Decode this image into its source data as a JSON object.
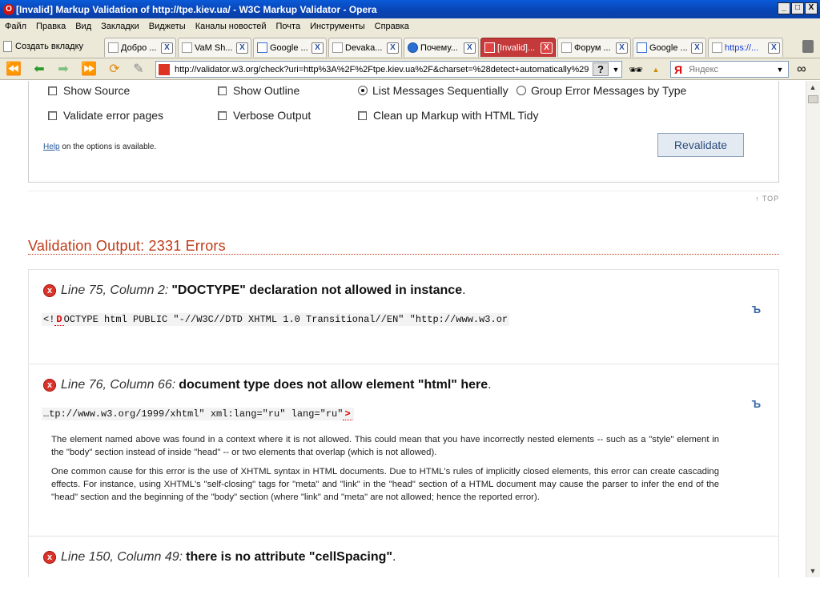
{
  "window": {
    "title": "[Invalid] Markup Validation of http://tpe.kiev.ua/ - W3C Markup Validator - Opera",
    "buttons": [
      "_",
      "□",
      "X"
    ]
  },
  "menu": [
    "Файл",
    "Правка",
    "Вид",
    "Закладки",
    "Виджеты",
    "Каналы новостей",
    "Почта",
    "Инструменты",
    "Справка"
  ],
  "tabs": {
    "new_tab_label": "Создать вкладку",
    "items": [
      {
        "label": "Добро ...",
        "favicon": "document-icon",
        "active": false
      },
      {
        "label": "VaM Sh...",
        "favicon": "document-icon",
        "active": false
      },
      {
        "label": "Google ...",
        "favicon": "google-icon",
        "active": false
      },
      {
        "label": "Devaka...",
        "favicon": "document-icon",
        "active": false
      },
      {
        "label": "Почему...",
        "favicon": "globe-icon",
        "active": false
      },
      {
        "label": "[Invalid]...",
        "favicon": "validator-icon",
        "active": true
      },
      {
        "label": "Форум ...",
        "favicon": "document-icon",
        "active": false
      },
      {
        "label": "Google ...",
        "favicon": "google-icon",
        "active": false
      },
      {
        "label": "https://...",
        "favicon": "document-icon",
        "active": false
      }
    ],
    "close_glyph": "X"
  },
  "address": {
    "url": "http://validator.w3.org/check?uri=http%3A%2F%2Ftpe.kiev.ua%2F&charset=%28detect+automatically%29",
    "help_glyph": "?",
    "search_engine_glyph": "Я",
    "search_placeholder": "Яндекс"
  },
  "options": {
    "show_source": "Show Source",
    "show_outline": "Show Outline",
    "list_sequential": "List Messages Sequentially",
    "group_by_type": "Group Error Messages by Type",
    "validate_error_pages": "Validate error pages",
    "verbose_output": "Verbose Output",
    "tidy": "Clean up Markup with HTML Tidy",
    "help_link": "Help",
    "help_rest": " on the options is available.",
    "revalidate": "Revalidate",
    "top_link": "↑ TOP"
  },
  "output": {
    "title": "Validation Output: 2331 Errors"
  },
  "messages": [
    {
      "location": "Line 75, Column 2",
      "text": "\"DOCTYPE\" declaration not allowed in instance",
      "src_before": "<!",
      "src_mark": "D",
      "src_after": "OCTYPE html PUBLIC \"-//W3C//DTD XHTML 1.0 Transitional//EN\" \"http://www.w3.or"
    },
    {
      "location": "Line 76, Column 66",
      "text": "document type does not allow element \"html\" here",
      "src_before": "…tp://www.w3.org/1999/xhtml\" xml:lang=\"ru\" lang=\"ru\"",
      "src_mark": ">",
      "src_after": "",
      "explain": [
        "The element named above was found in a context where it is not allowed. This could mean that you have incorrectly nested elements -- such as a \"style\" element in the \"body\" section instead of inside \"head\" -- or two elements that overlap (which is not allowed).",
        "One common cause for this error is the use of XHTML syntax in HTML documents. Due to HTML's rules of implicitly closed elements, this error can create cascading effects. For instance, using XHTML's \"self-closing\" tags for \"meta\" and \"link\" in the \"head\" section of a HTML document may cause the parser to infer the end of the \"head\" section and the beginning of the \"body\" section (where \"link\" and \"meta\" are not allowed; hence the reported error)."
      ]
    },
    {
      "location": "Line 150, Column 49",
      "text": "there is no attribute \"cellSpacing\""
    }
  ],
  "glyphs": {
    "error": "x",
    "fix": "Ъ",
    "period": ".",
    "colon": ":"
  },
  "colors": {
    "title_bar": "#0a5ad8",
    "chrome": "#ece9d8",
    "output_title": "#bf3a16",
    "error_icon": "#d9342b",
    "active_tab": "#c43a3a"
  }
}
